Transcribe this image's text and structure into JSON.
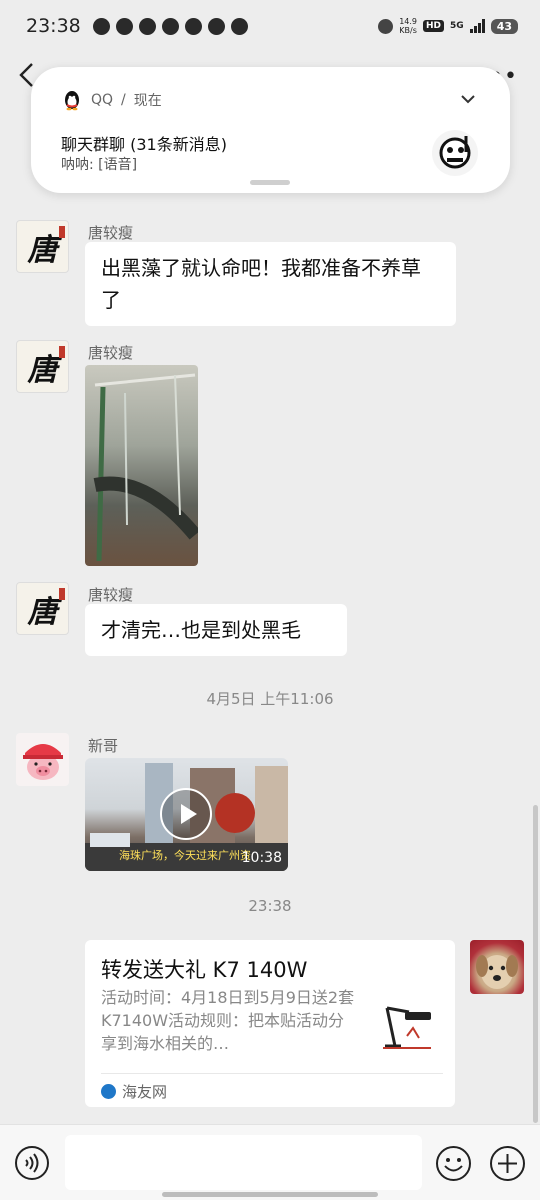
{
  "status_bar": {
    "time": "23:38",
    "net_speed_value": "14.9",
    "net_speed_unit": "KB/s",
    "hd": "HD",
    "network": "5G",
    "battery": "43"
  },
  "notification": {
    "app": "QQ",
    "when": "现在",
    "title": "聊天群聊 (31条新消息)",
    "body": "呐呐: [语音]"
  },
  "messages": [
    {
      "sender": "唐较瘦",
      "text": "出黑藻了就认命吧！我都准备不养草了",
      "avatar_char": "唐"
    },
    {
      "sender": "唐较瘦",
      "type": "image",
      "avatar_char": "唐"
    },
    {
      "sender": "唐较瘦",
      "text": "才清完…也是到处黑毛",
      "avatar_char": "唐"
    },
    {
      "sender": "新哥",
      "type": "video",
      "caption": "海珠广场，今天过来广州资",
      "duration": "10:38"
    }
  ],
  "timestamps": [
    "4月5日 上午11:06",
    "23:38"
  ],
  "link_card": {
    "title": "转发送大礼 K7 140W",
    "description": "活动时间：4月18日到5月9日送2套K7140W活动规则：把本贴活动分享到海水相关的…",
    "source": "海友网"
  },
  "input_bar": {
    "placeholder": ""
  },
  "colors": {
    "background": "#ededed",
    "bubble": "#ffffff",
    "accent_seal": "#c0392b"
  }
}
